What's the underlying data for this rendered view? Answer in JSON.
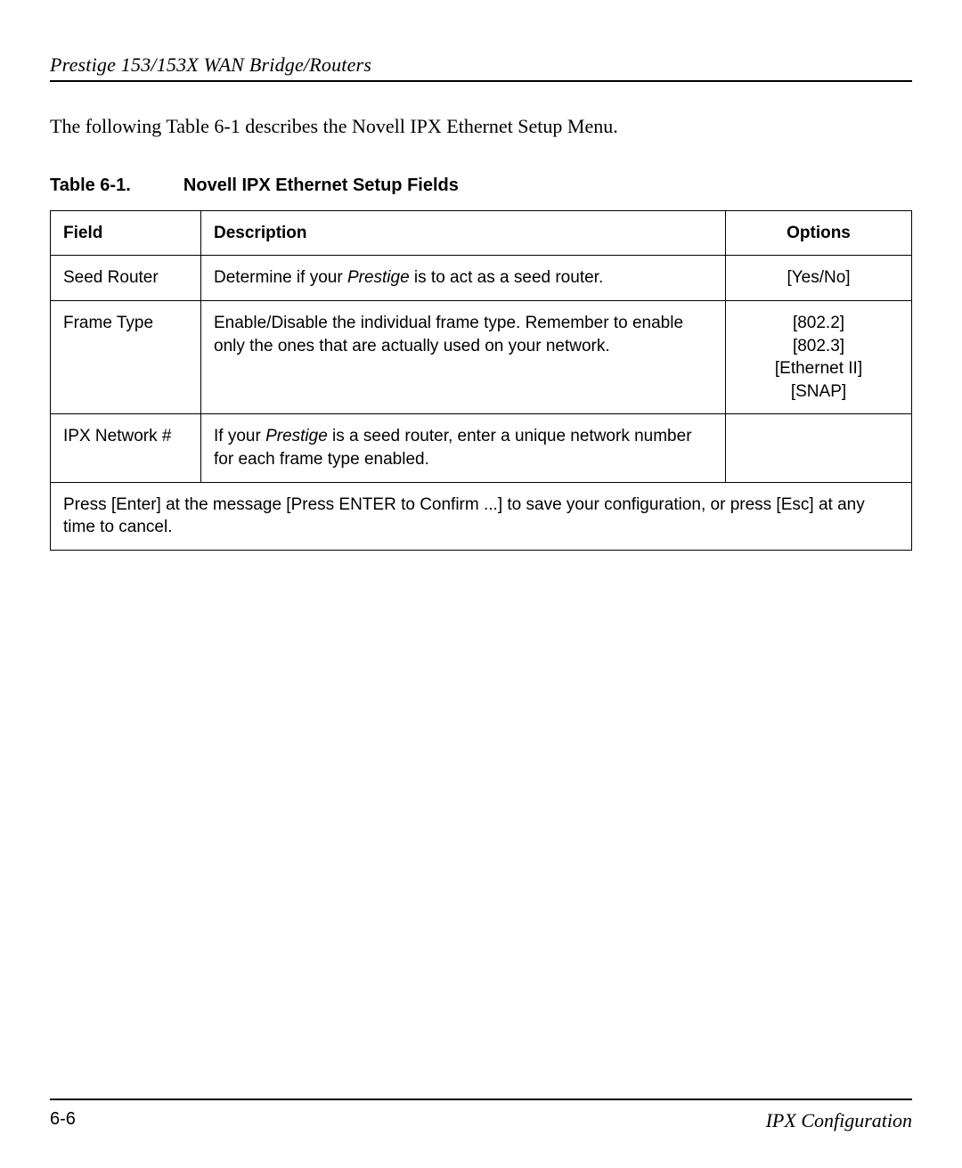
{
  "header": {
    "running_title": "Prestige 153/153X  WAN Bridge/Routers"
  },
  "intro": "The following Table 6-1 describes the Novell IPX Ethernet Setup Menu.",
  "table_caption": {
    "number": "Table 6-1.",
    "title": "Novell IPX Ethernet Setup Fields"
  },
  "table": {
    "headers": {
      "field": "Field",
      "description": "Description",
      "options": "Options"
    },
    "rows": [
      {
        "field": "Seed Router",
        "desc_pre": "Determine if your ",
        "desc_ital": "Prestige",
        "desc_post": " is to act as a seed router.",
        "options": [
          "[Yes/No]"
        ]
      },
      {
        "field": "Frame Type",
        "desc_pre": "Enable/Disable the individual frame type.  Remember to enable only the ones that are actually used on your network.",
        "desc_ital": "",
        "desc_post": "",
        "options": [
          "[802.2]",
          "[802.3]",
          "[Ethernet II]",
          "[SNAP]"
        ]
      },
      {
        "field": "IPX Network #",
        "desc_pre": "If your ",
        "desc_ital": "Prestige",
        "desc_post": " is a seed router, enter a unique network number for each frame type enabled.",
        "options": []
      }
    ],
    "footer_note": "Press [Enter] at the message [Press ENTER to Confirm ...] to save your configuration, or press [Esc] at any time to cancel."
  },
  "footer": {
    "page_number": "6-6",
    "section": "IPX Configuration"
  }
}
